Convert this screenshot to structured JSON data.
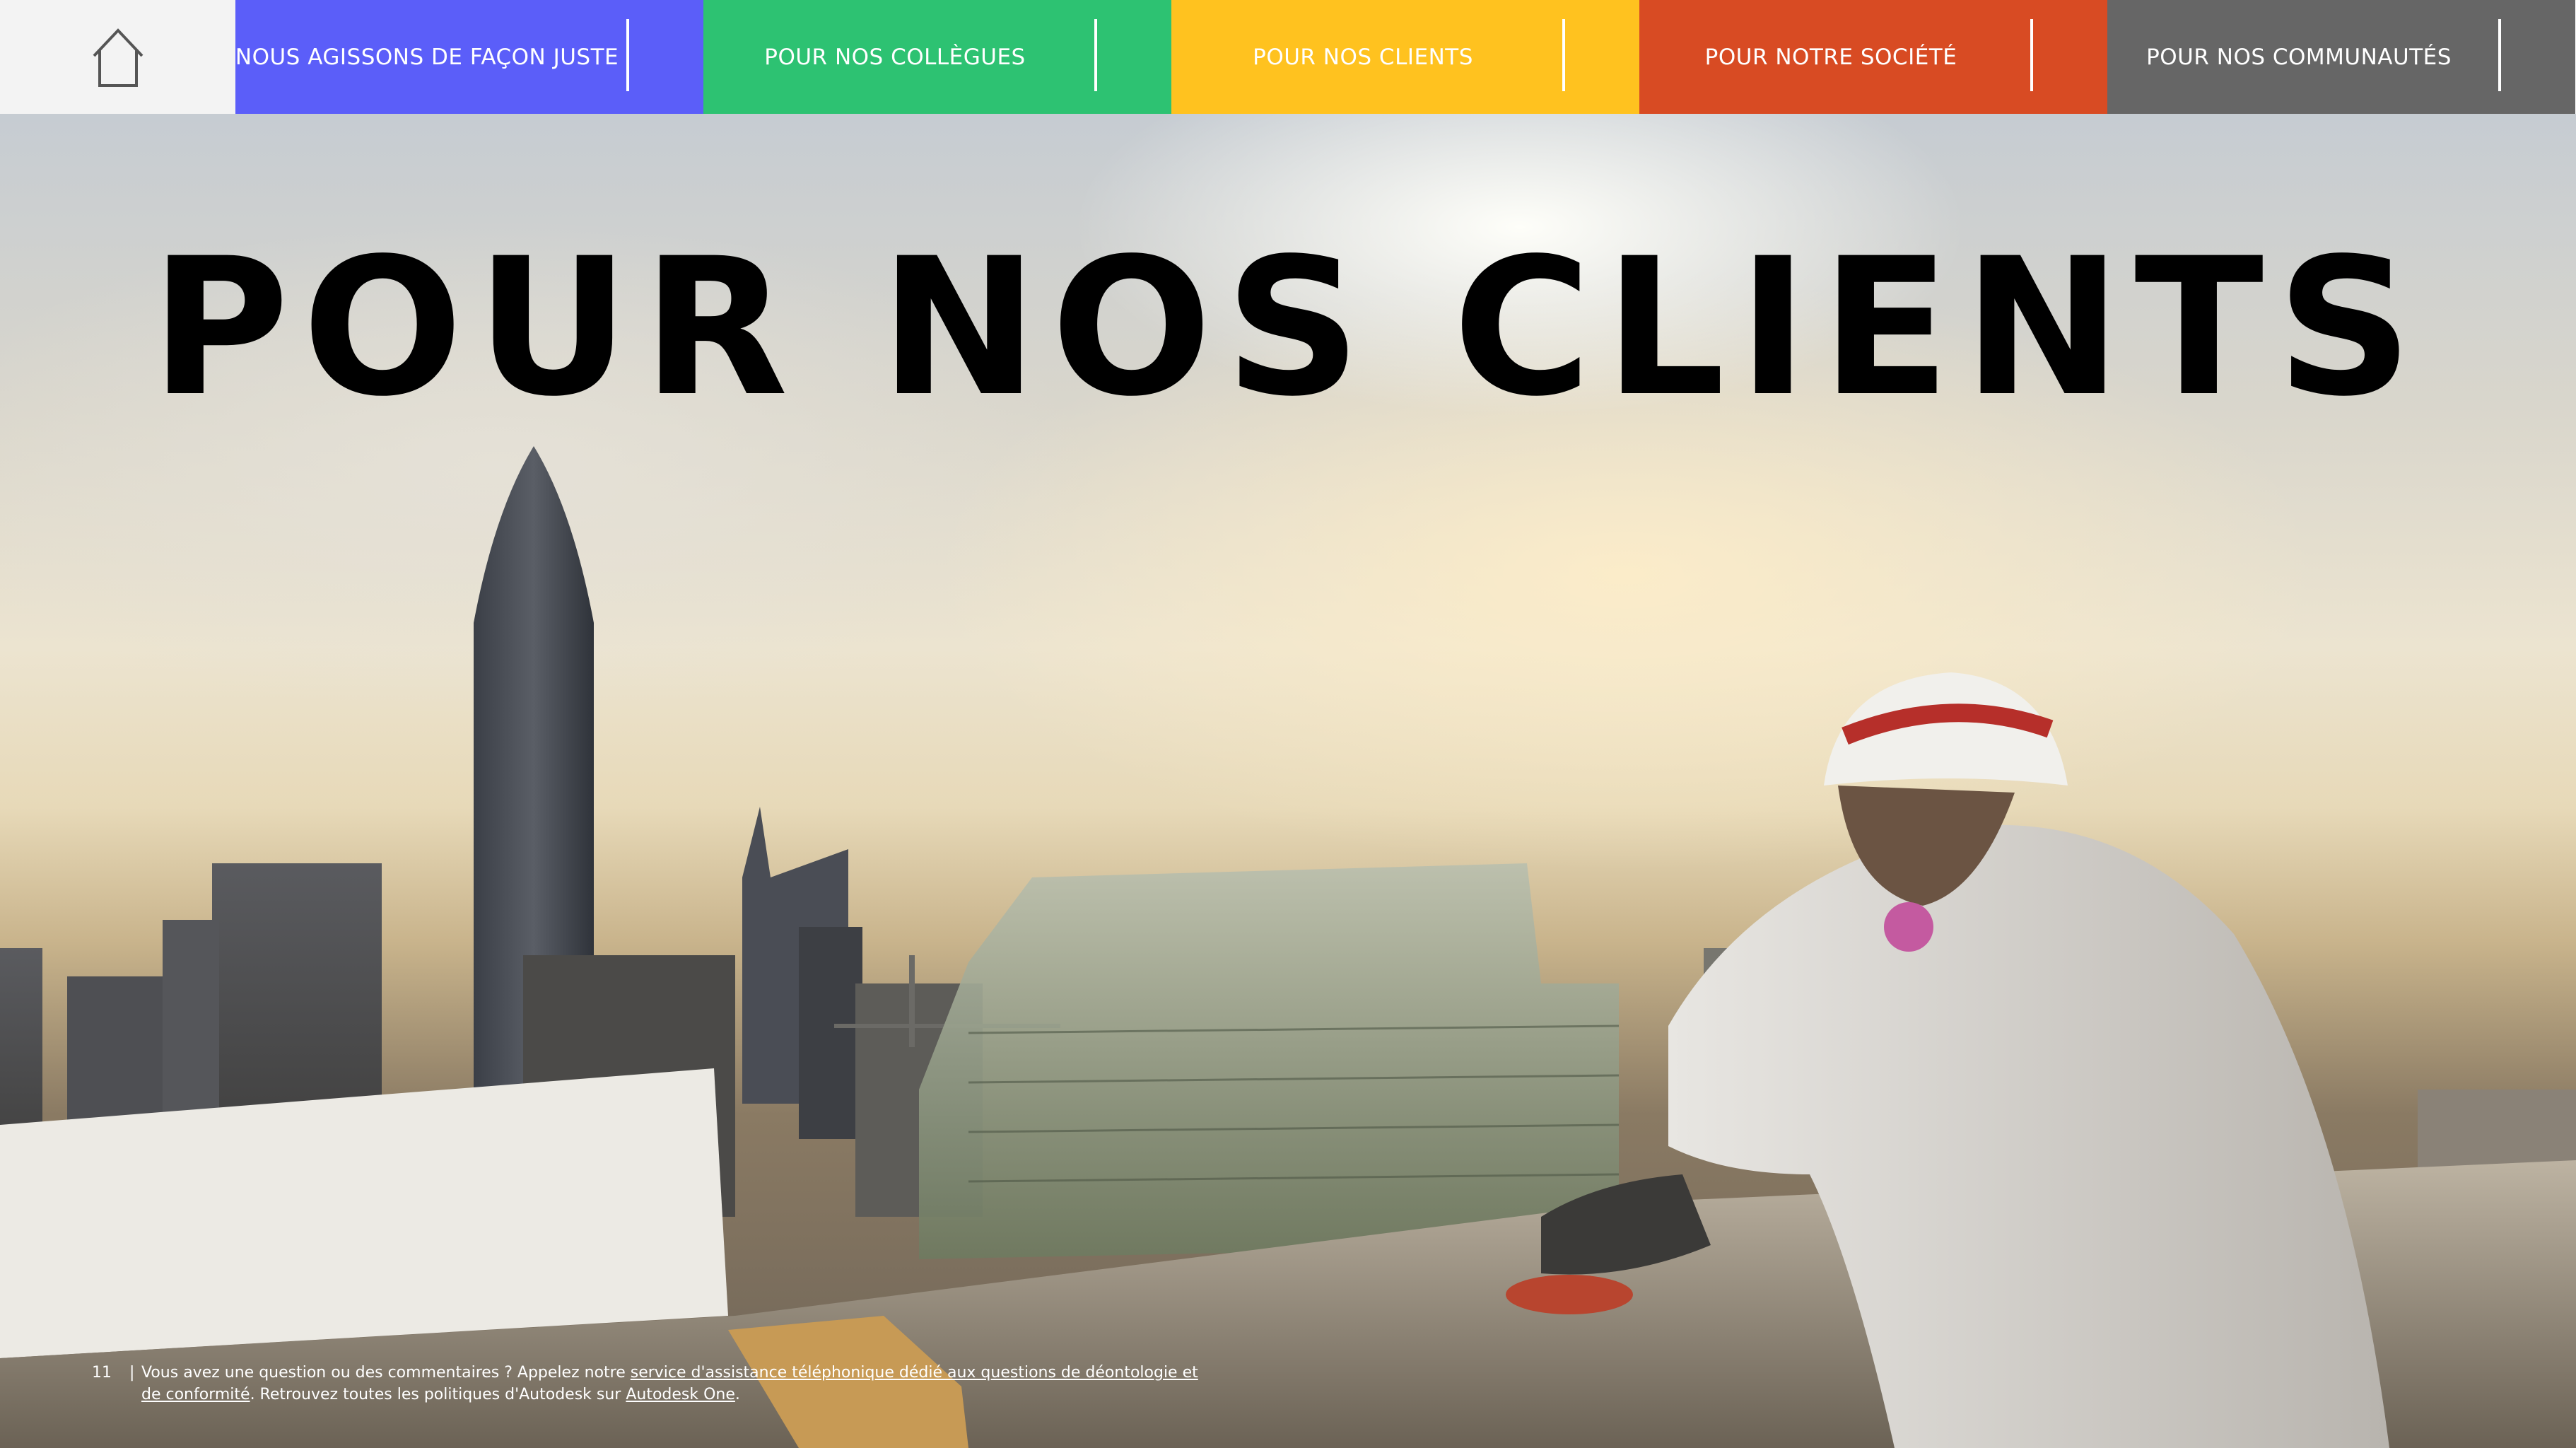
{
  "nav": {
    "home_icon": "house-icon",
    "tabs": [
      {
        "label": "NOUS AGISSONS DE FAÇON JUSTE",
        "color": "#5b5ef9"
      },
      {
        "label": "POUR NOS COLLÈGUES",
        "color": "#2dc272"
      },
      {
        "label": "POUR NOS CLIENTS",
        "color": "#ffc21f"
      },
      {
        "label": "POUR NOTRE SOCIÉTÉ",
        "color": "#d84b23"
      },
      {
        "label": "POUR NOS COMMUNAUTÉS",
        "color": "#666666"
      }
    ],
    "home_bg": "#f3f3f3"
  },
  "hero": {
    "title": "POUR NOS CLIENTS"
  },
  "footer": {
    "page_number": "11",
    "separator": "|",
    "text_before": "Vous avez une question ou des commentaires ? Appelez notre ",
    "link_hotline": "service d'assistance téléphonique dédié aux questions de déontologie et de conformité",
    "text_middle": ". Retrouvez toutes les politiques d'Autodesk sur ",
    "link_autodesk_one": "Autodesk One",
    "text_end": "."
  }
}
